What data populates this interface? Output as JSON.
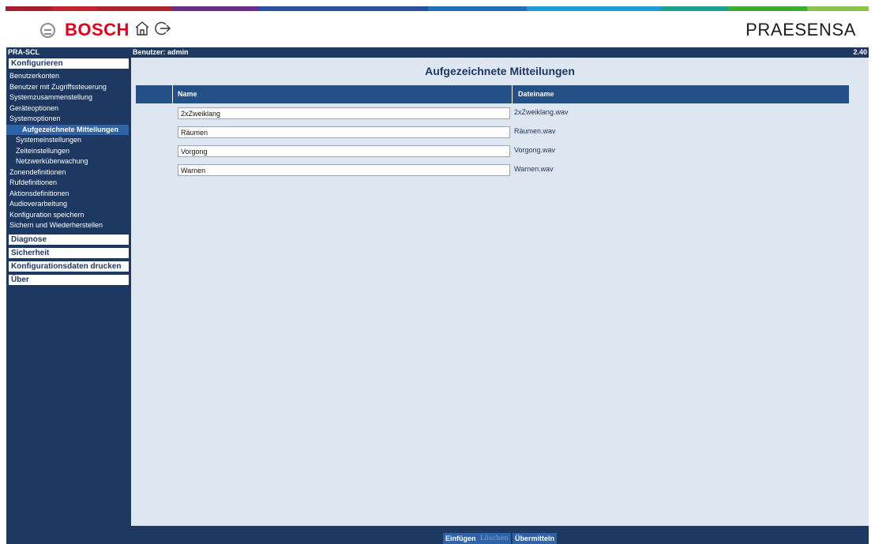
{
  "header": {
    "brand": "BOSCH",
    "product": "PRAESENSA",
    "color_strips": [
      "#a61f30",
      "#c12532",
      "#6a2e86",
      "#2a4f9c",
      "#1e6fb6",
      "#1a9ed6",
      "#19a38e",
      "#3fa83a",
      "#8cc24a"
    ]
  },
  "topbar": {
    "device": "PRA-SCL",
    "user": "Benutzer: admin",
    "version": "2.40"
  },
  "sidebar": {
    "section_configure": "Konfigurieren",
    "items": [
      {
        "label": "Benutzerkonten"
      },
      {
        "label": "Benutzer mit Zugriffssteuerung"
      },
      {
        "label": "Systemzusammenstellung"
      },
      {
        "label": "Geräteoptionen"
      },
      {
        "label": "Systemoptionen"
      },
      {
        "label": "Aufgezeichnete Mitteilungen"
      },
      {
        "label": "Systemeinstellungen"
      },
      {
        "label": "Zeiteinstellungen"
      },
      {
        "label": "Netzwerküberwachung"
      },
      {
        "label": "Zonendefinitionen"
      },
      {
        "label": "Rufdefinitionen"
      },
      {
        "label": "Aktionsdefinitionen"
      },
      {
        "label": "Audioverarbeitung"
      },
      {
        "label": "Konfiguration speichern"
      },
      {
        "label": "Sichern und Wiederherstellen"
      }
    ],
    "sections": [
      "Diagnose",
      "Sicherheit",
      "Konfigurationsdaten drucken",
      "Über"
    ]
  },
  "main": {
    "title": "Aufgezeichnete Mitteilungen",
    "columns": {
      "name": "Name",
      "file": "Dateiname"
    },
    "rows": [
      {
        "name": "2xZweiklang",
        "file": "2xZweiklang.wav"
      },
      {
        "name": "Räumen",
        "file": "Räumen.wav"
      },
      {
        "name": "Vorgong",
        "file": "Vorgong.wav"
      },
      {
        "name": "Warnen",
        "file": "Warnen.wav"
      }
    ]
  },
  "footer": {
    "insert": "Einfügen",
    "delete": "Löschen",
    "submit": "Übermitteln"
  }
}
